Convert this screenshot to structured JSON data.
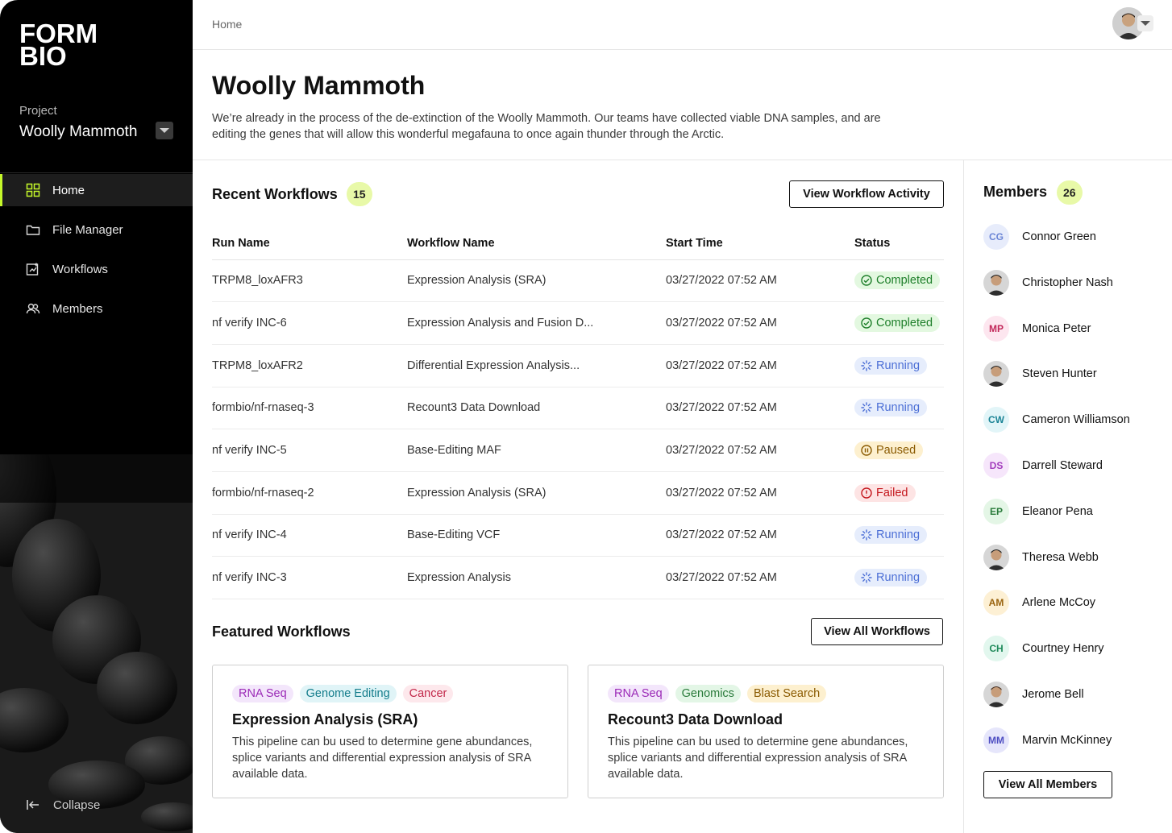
{
  "brand": {
    "line1": "FORM",
    "line2": "BIO"
  },
  "project": {
    "label": "Project",
    "name": "Woolly Mammoth"
  },
  "nav": [
    {
      "label": "Home",
      "icon": "grid-icon",
      "active": true
    },
    {
      "label": "File Manager",
      "icon": "folder-icon"
    },
    {
      "label": "Workflows",
      "icon": "workflow-icon"
    },
    {
      "label": "Members",
      "icon": "members-icon"
    }
  ],
  "collapse_label": "Collapse",
  "breadcrumb": "Home",
  "page": {
    "title": "Woolly Mammoth",
    "description": "We’re already in the process of the de-extinction of the Woolly Mammoth. Our teams have collected viable DNA samples, and are editing the genes that will allow this wonderful megafauna to once again thunder through the Arctic."
  },
  "recent": {
    "title": "Recent Workflows",
    "count": "15",
    "button": "View Workflow Activity",
    "columns": [
      "Run Name",
      "Workflow Name",
      "Start Time",
      "Status"
    ],
    "rows": [
      {
        "run": "TRPM8_loxAFR3",
        "workflow": "Expression Analysis (SRA)",
        "start": "03/27/2022 07:52 AM",
        "status": "Completed",
        "kind": "completed"
      },
      {
        "run": "nf verify INC-6",
        "workflow": "Expression Analysis and Fusion D...",
        "start": "03/27/2022 07:52 AM",
        "status": "Completed",
        "kind": "completed"
      },
      {
        "run": "TRPM8_loxAFR2",
        "workflow": "Differential Expression Analysis...",
        "start": "03/27/2022 07:52 AM",
        "status": "Running",
        "kind": "running"
      },
      {
        "run": "formbio/nf-rnaseq-3",
        "workflow": "Recount3 Data Download",
        "start": "03/27/2022 07:52 AM",
        "status": "Running",
        "kind": "running"
      },
      {
        "run": "nf verify INC-5",
        "workflow": "Base-Editing MAF",
        "start": "03/27/2022 07:52 AM",
        "status": "Paused",
        "kind": "paused"
      },
      {
        "run": "formbio/nf-rnaseq-2",
        "workflow": "Expression Analysis (SRA)",
        "start": "03/27/2022 07:52 AM",
        "status": "Failed",
        "kind": "failed"
      },
      {
        "run": "nf verify INC-4",
        "workflow": "Base-Editing VCF",
        "start": "03/27/2022 07:52 AM",
        "status": "Running",
        "kind": "running"
      },
      {
        "run": "nf verify INC-3",
        "workflow": "Expression Analysis",
        "start": "03/27/2022 07:52 AM",
        "status": "Running",
        "kind": "running"
      }
    ]
  },
  "featured": {
    "title": "Featured Workflows",
    "button": "View All Workflows",
    "cards": [
      {
        "tags": [
          {
            "label": "RNA Seq",
            "color": "purple"
          },
          {
            "label": "Genome Editing",
            "color": "teal"
          },
          {
            "label": "Cancer",
            "color": "pink"
          }
        ],
        "title": "Expression Analysis (SRA)",
        "description": "This pipeline can bu used to determine gene abundances, splice variants and differential expression analysis of SRA available data."
      },
      {
        "tags": [
          {
            "label": "RNA Seq",
            "color": "purple"
          },
          {
            "label": "Genomics",
            "color": "green"
          },
          {
            "label": "Blast Search",
            "color": "amber"
          }
        ],
        "title": "Recount3 Data Download",
        "description": "This pipeline can bu used to determine gene abundances, splice variants and differential expression analysis of SRA available data."
      }
    ]
  },
  "members": {
    "title": "Members",
    "count": "26",
    "button": "View All  Members",
    "list": [
      {
        "name": "Connor Green",
        "initials": "CG",
        "bg": "#e7ecfb",
        "fg": "#6c86d6"
      },
      {
        "name": "Christopher Nash",
        "photo": true
      },
      {
        "name": "Monica Peter",
        "initials": "MP",
        "bg": "#fde6ef",
        "fg": "#c2285a"
      },
      {
        "name": "Steven Hunter",
        "photo": true
      },
      {
        "name": "Cameron Williamson",
        "initials": "CW",
        "bg": "#e2f5f8",
        "fg": "#1c8496"
      },
      {
        "name": "Darrell Steward",
        "initials": "DS",
        "bg": "#f6e6fb",
        "fg": "#a23cbc"
      },
      {
        "name": "Eleanor Pena",
        "initials": "EP",
        "bg": "#e4f6e6",
        "fg": "#2a7b3b"
      },
      {
        "name": "Theresa Webb",
        "photo": true
      },
      {
        "name": "Arlene McCoy",
        "initials": "AM",
        "bg": "#fdf0d4",
        "fg": "#9a6410"
      },
      {
        "name": "Courtney Henry",
        "initials": "CH",
        "bg": "#e2f7ee",
        "fg": "#1f8a5a"
      },
      {
        "name": "Jerome Bell",
        "photo": true
      },
      {
        "name": "Marvin McKinney",
        "initials": "MM",
        "bg": "#e6e6fb",
        "fg": "#4f4fc2"
      }
    ]
  },
  "colors": {
    "accent": "#c5f82a",
    "sidebar": "#000000"
  }
}
